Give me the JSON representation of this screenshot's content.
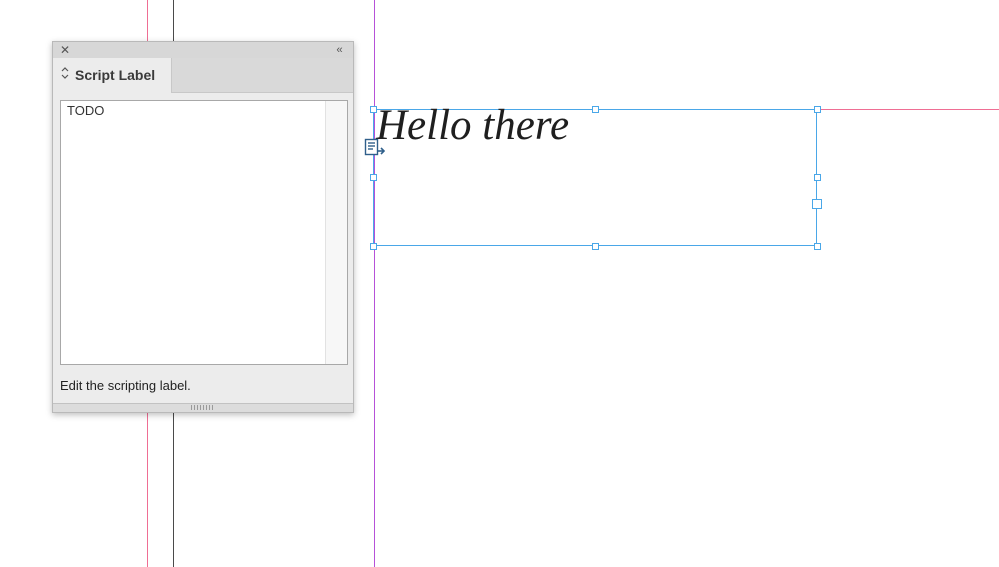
{
  "panel": {
    "close_icon": "close-icon",
    "collapse_icon": "double-chevron-left-icon",
    "collapse_glyph": "‹‹",
    "close_glyph": "✕",
    "tab": {
      "label": "Script Label",
      "chevron_icon": "up-down-chevron-icon",
      "chevron_glyph": "⌃⌄"
    },
    "label_value": "TODO",
    "help_text": "Edit the scripting label."
  },
  "document": {
    "frame_text": "Hello there",
    "story_icon": "text-frame-story-icon"
  },
  "colors": {
    "selection": "#4aa7e8",
    "guide_pink": "#ef6e94",
    "guide_purple": "#b651d8",
    "guide_dark": "#4a4a4a"
  }
}
